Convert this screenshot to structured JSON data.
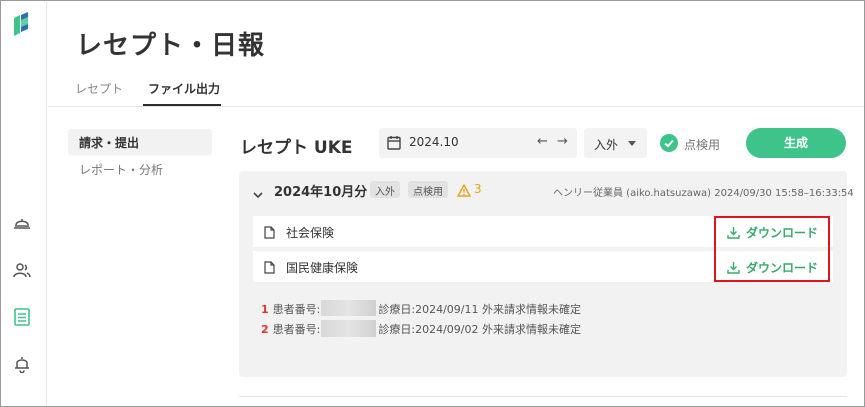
{
  "page": {
    "title": "レセプト・日報"
  },
  "tabs": [
    {
      "label": "レセプト"
    },
    {
      "label": "ファイル出力"
    }
  ],
  "side_menu": [
    {
      "label": "請求・提出"
    },
    {
      "label": "レポート・分析"
    }
  ],
  "section": {
    "title": "レセプト UKE"
  },
  "toolbar": {
    "date_value": "2024.10",
    "prev": "←",
    "next": "→",
    "select_value": "入外",
    "check_label": "点検用",
    "generate_label": "生成"
  },
  "card": {
    "title": "2024年10月分",
    "badges": [
      "入外",
      "点検用"
    ],
    "warning_count": "3",
    "meta": "ヘンリー従業員 (aiko.hatsuzawa)  2024/09/30 15:58–16:33:54",
    "files": [
      {
        "name": "社会保険",
        "download_label": "ダウンロード"
      },
      {
        "name": "国民健康保険",
        "download_label": "ダウンロード"
      }
    ],
    "errors": [
      {
        "num": "1",
        "prefix": "患者番号:",
        "text": "診療日:2024/09/11 外来請求情報未確定"
      },
      {
        "num": "2",
        "prefix": "患者番号:",
        "text": "診療日:2024/09/02 外来請求情報未確定"
      }
    ]
  },
  "colors": {
    "accent": "#3ec48a",
    "download": "#3aa96e",
    "warning": "#e8a317",
    "error_num": "#d9382e",
    "highlight": "#e0141e"
  }
}
